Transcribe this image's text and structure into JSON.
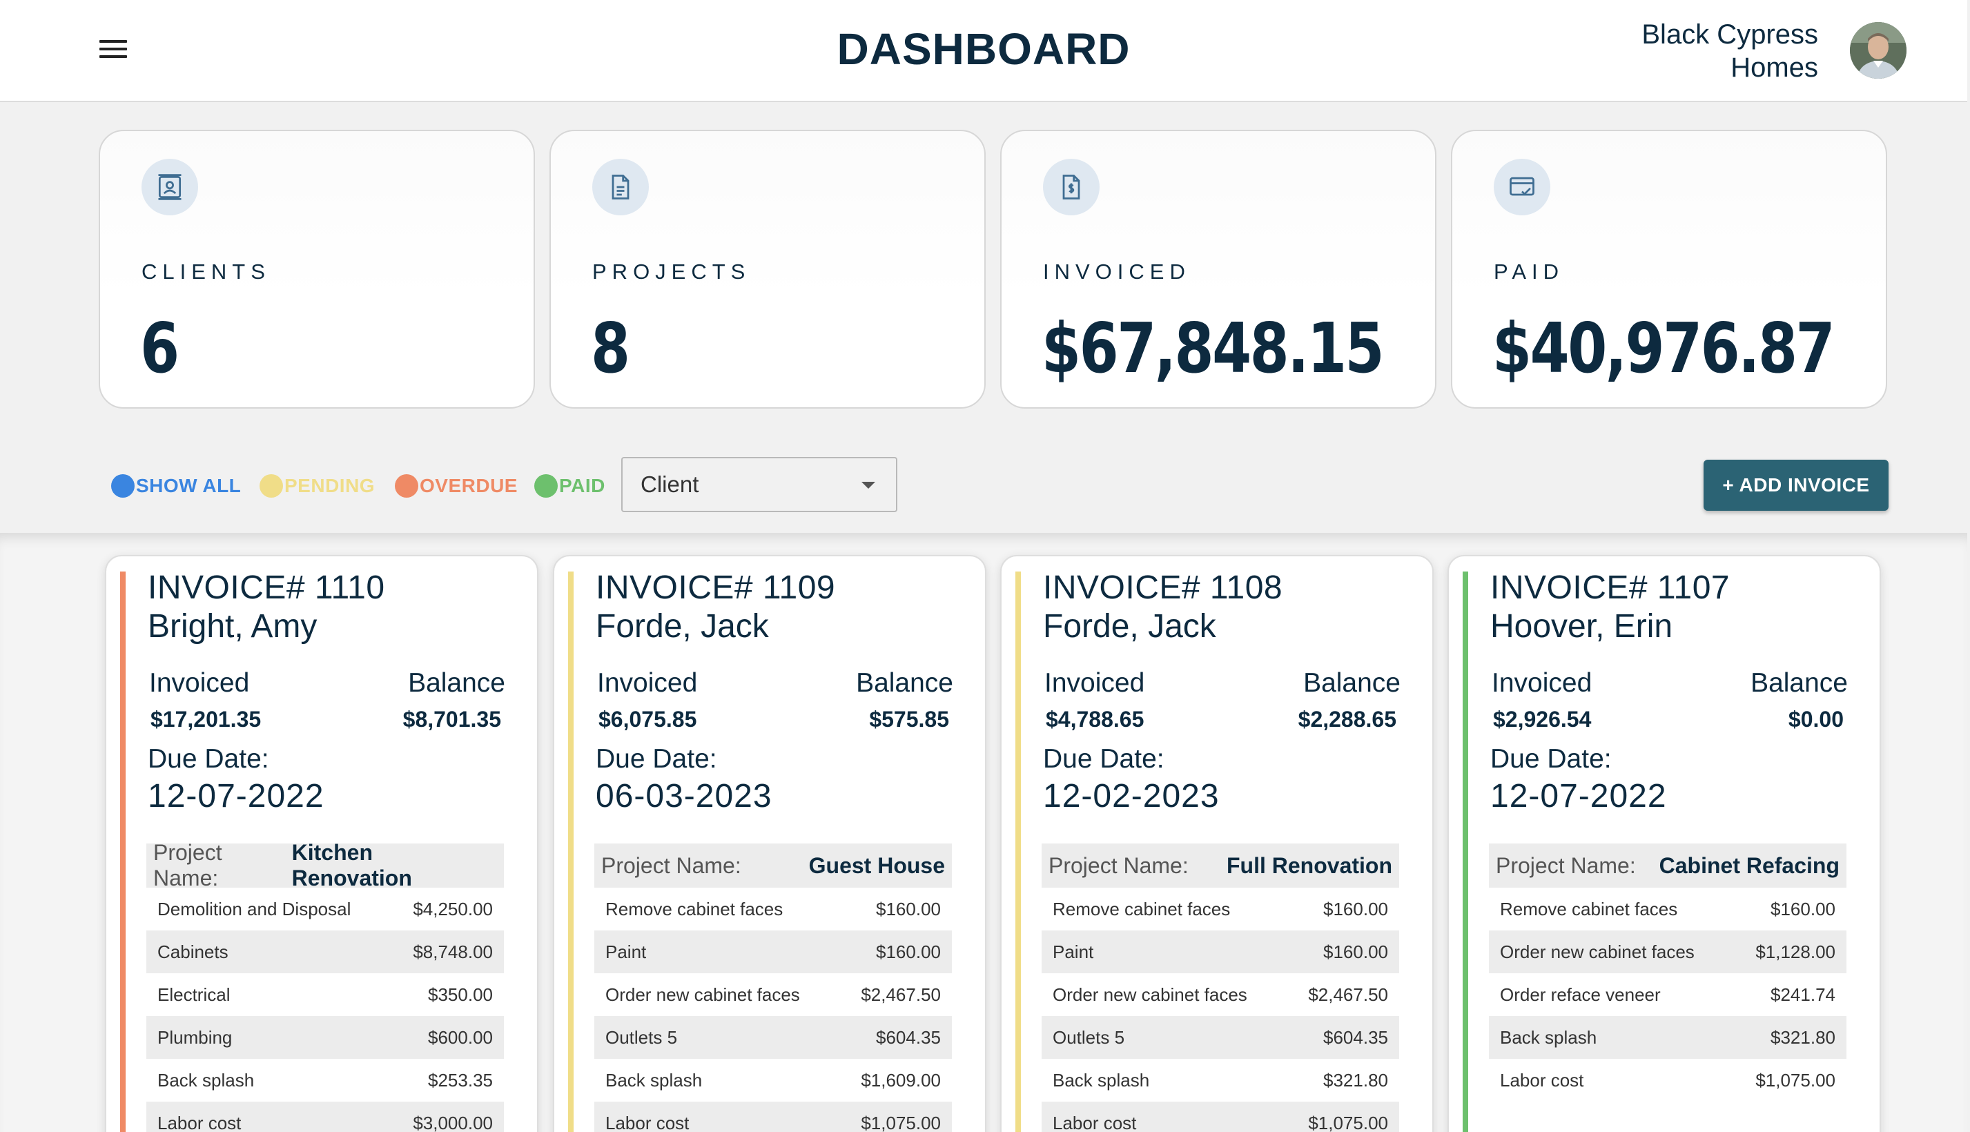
{
  "header": {
    "title": "DASHBOARD",
    "company_line1": "Black Cypress",
    "company_line2": "Homes"
  },
  "stats": [
    {
      "label": "CLIENTS",
      "value": "6",
      "icon": "contact-card-icon"
    },
    {
      "label": "PROJECTS",
      "value": "8",
      "icon": "document-icon"
    },
    {
      "label": "INVOICED",
      "value": "$67,848.15",
      "icon": "dollar-document-icon"
    },
    {
      "label": "PAID",
      "value": "$40,976.87",
      "icon": "card-check-icon"
    }
  ],
  "filters": {
    "show_all": {
      "label": "SHOW ALL",
      "color": "#3a85e0"
    },
    "pending": {
      "label": "PENDING",
      "color": "#f0dd88"
    },
    "overdue": {
      "label": "OVERDUE",
      "color": "#ef8a65"
    },
    "paid": {
      "label": "PAID",
      "color": "#6dc06d"
    },
    "client_select": "Client",
    "add_invoice": "+ ADD INVOICE"
  },
  "labels": {
    "invoiced": "Invoiced",
    "balance": "Balance",
    "due_date": "Due Date:",
    "project_name": "Project Name:"
  },
  "invoices": [
    {
      "number": "INVOICE# 1110",
      "client": "Bright, Amy",
      "invoiced": "$17,201.35",
      "balance": "$8,701.35",
      "due_date": "12-07-2022",
      "status_color": "#ef8a65",
      "project": "Kitchen Renovation",
      "items": [
        {
          "name": "Demolition and Disposal",
          "amount": "$4,250.00"
        },
        {
          "name": "Cabinets",
          "amount": "$8,748.00"
        },
        {
          "name": "Electrical",
          "amount": "$350.00"
        },
        {
          "name": "Plumbing",
          "amount": "$600.00"
        },
        {
          "name": "Back splash",
          "amount": "$253.35"
        },
        {
          "name": "Labor cost",
          "amount": "$3,000.00"
        }
      ]
    },
    {
      "number": "INVOICE# 1109",
      "client": "Forde, Jack",
      "invoiced": "$6,075.85",
      "balance": "$575.85",
      "due_date": "06-03-2023",
      "status_color": "#f0dd88",
      "project": "Guest House",
      "items": [
        {
          "name": "Remove cabinet faces",
          "amount": "$160.00"
        },
        {
          "name": "Paint",
          "amount": "$160.00"
        },
        {
          "name": "Order new cabinet faces",
          "amount": "$2,467.50"
        },
        {
          "name": "Outlets 5",
          "amount": "$604.35"
        },
        {
          "name": "Back splash",
          "amount": "$1,609.00"
        },
        {
          "name": "Labor cost",
          "amount": "$1,075.00"
        }
      ]
    },
    {
      "number": "INVOICE# 1108",
      "client": "Forde, Jack",
      "invoiced": "$4,788.65",
      "balance": "$2,288.65",
      "due_date": "12-02-2023",
      "status_color": "#f0dd88",
      "project": "Full Renovation",
      "items": [
        {
          "name": "Remove cabinet faces",
          "amount": "$160.00"
        },
        {
          "name": "Paint",
          "amount": "$160.00"
        },
        {
          "name": "Order new cabinet faces",
          "amount": "$2,467.50"
        },
        {
          "name": "Outlets 5",
          "amount": "$604.35"
        },
        {
          "name": "Back splash",
          "amount": "$321.80"
        },
        {
          "name": "Labor cost",
          "amount": "$1,075.00"
        }
      ]
    },
    {
      "number": "INVOICE# 1107",
      "client": "Hoover, Erin",
      "invoiced": "$2,926.54",
      "balance": "$0.00",
      "due_date": "12-07-2022",
      "status_color": "#6dc06d",
      "project": "Cabinet Refacing",
      "items": [
        {
          "name": "Remove cabinet faces",
          "amount": "$160.00"
        },
        {
          "name": "Order new cabinet faces",
          "amount": "$1,128.00"
        },
        {
          "name": "Order reface veneer",
          "amount": "$241.74"
        },
        {
          "name": "Back splash",
          "amount": "$321.80"
        },
        {
          "name": "Labor cost",
          "amount": "$1,075.00"
        }
      ]
    }
  ]
}
